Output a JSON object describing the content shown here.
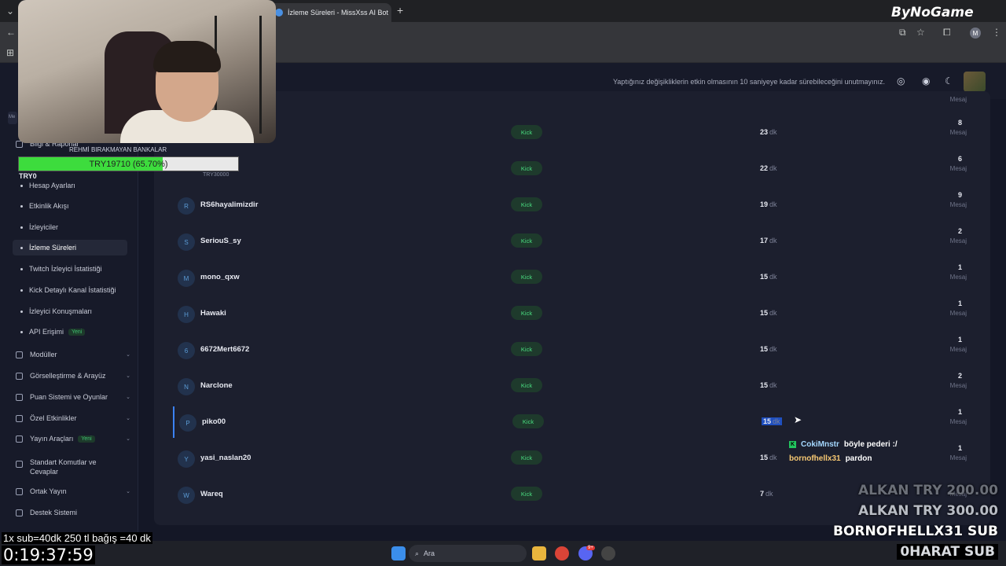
{
  "browser": {
    "tab_title": "İzleme Süreleri - MissXss AI Bot",
    "new_tab": "+",
    "profile_initial": "M"
  },
  "brand": "ByNoGame",
  "topbar": {
    "notice": "Yaptığınız değişikliklerin etkin olmasının 10 saniyeye kadar sürebileceğini unutmayınız."
  },
  "sidebar": {
    "partial_item": "Bilgi & Raporlar",
    "search_partial": "Me",
    "items": [
      {
        "label": "Hesap Ayarları"
      },
      {
        "label": "Etkinlik Akışı"
      },
      {
        "label": "İzleyiciler"
      },
      {
        "label": "İzleme Süreleri"
      },
      {
        "label": "Twitch İzleyici İstatistiği"
      },
      {
        "label": "Kick Detaylı Kanal İstatistiği"
      },
      {
        "label": "İzleyici Konuşmaları"
      },
      {
        "label": "API Erişimi",
        "badge": "Yeni"
      }
    ],
    "sections": [
      {
        "label": "Modüller"
      },
      {
        "label": "Görselleştirme & Arayüz"
      },
      {
        "label": "Puan Sistemi ve Oyunlar"
      },
      {
        "label": "Özel Etkinlikler"
      },
      {
        "label": "Yayın Araçları",
        "badge": "Yeni"
      },
      {
        "label": "Standart Komutlar ve Cevaplar"
      },
      {
        "label": "Ortak Yayın"
      },
      {
        "label": "Destek Sistemi"
      }
    ]
  },
  "table": {
    "unit": "dk",
    "msg_label": "Mesaj",
    "platform": "Kick",
    "rows": [
      {
        "initial": "",
        "name": "",
        "duration": "",
        "messages": ""
      },
      {
        "initial": "",
        "name": "",
        "duration": "23",
        "messages": "8"
      },
      {
        "initial": "",
        "name": "",
        "duration": "22",
        "messages": "6"
      },
      {
        "initial": "R",
        "name": "RS6hayalimizdir",
        "duration": "19",
        "messages": "9"
      },
      {
        "initial": "S",
        "name": "SeriouS_sy",
        "duration": "17",
        "messages": "2"
      },
      {
        "initial": "M",
        "name": "mono_qxw",
        "duration": "15",
        "messages": "1"
      },
      {
        "initial": "H",
        "name": "Hawaki",
        "duration": "15",
        "messages": "1"
      },
      {
        "initial": "6",
        "name": "6672Mert6672",
        "duration": "15",
        "messages": "1"
      },
      {
        "initial": "N",
        "name": "Narclone",
        "duration": "15",
        "messages": "2"
      },
      {
        "initial": "P",
        "name": "piko00",
        "duration": "15",
        "messages": "1"
      },
      {
        "initial": "Y",
        "name": "yasi_naslan20",
        "duration": "15",
        "messages": "1"
      },
      {
        "initial": "W",
        "name": "Wareq",
        "duration": "7",
        "messages": ""
      }
    ]
  },
  "overlay": {
    "goal_title": "REHMİ BIRAKMAYAN BANKALAR",
    "goal_text": "TRY19710 (65.70%)",
    "goal_progress": 0.657,
    "goal_start": "TRY0",
    "goal_end": "TRY30000",
    "chat": [
      {
        "user": "CokiMnstr",
        "message": "böyle pederi :/",
        "color": "#a5d8ff"
      },
      {
        "user": "bornofhellx31",
        "message": "pardon",
        "color": "#f7c873"
      }
    ],
    "donations": [
      {
        "text": "ALKAN  TRY 200.00",
        "color": "#6b6f78"
      },
      {
        "text": "ALKAN  TRY 300.00",
        "color": "#b8bcc4"
      },
      {
        "text": "BORNOFHELLX31  SUB",
        "color": "#ffffff"
      },
      {
        "text": "0HARAT  SUB",
        "color": "#d8dbe0"
      }
    ],
    "bottom_note": "1x sub=40dk 250 tl bağış =40 dk",
    "timer": "0:19:37:59"
  },
  "taskbar": {
    "search": "Ara",
    "discord_badge": "9+"
  }
}
